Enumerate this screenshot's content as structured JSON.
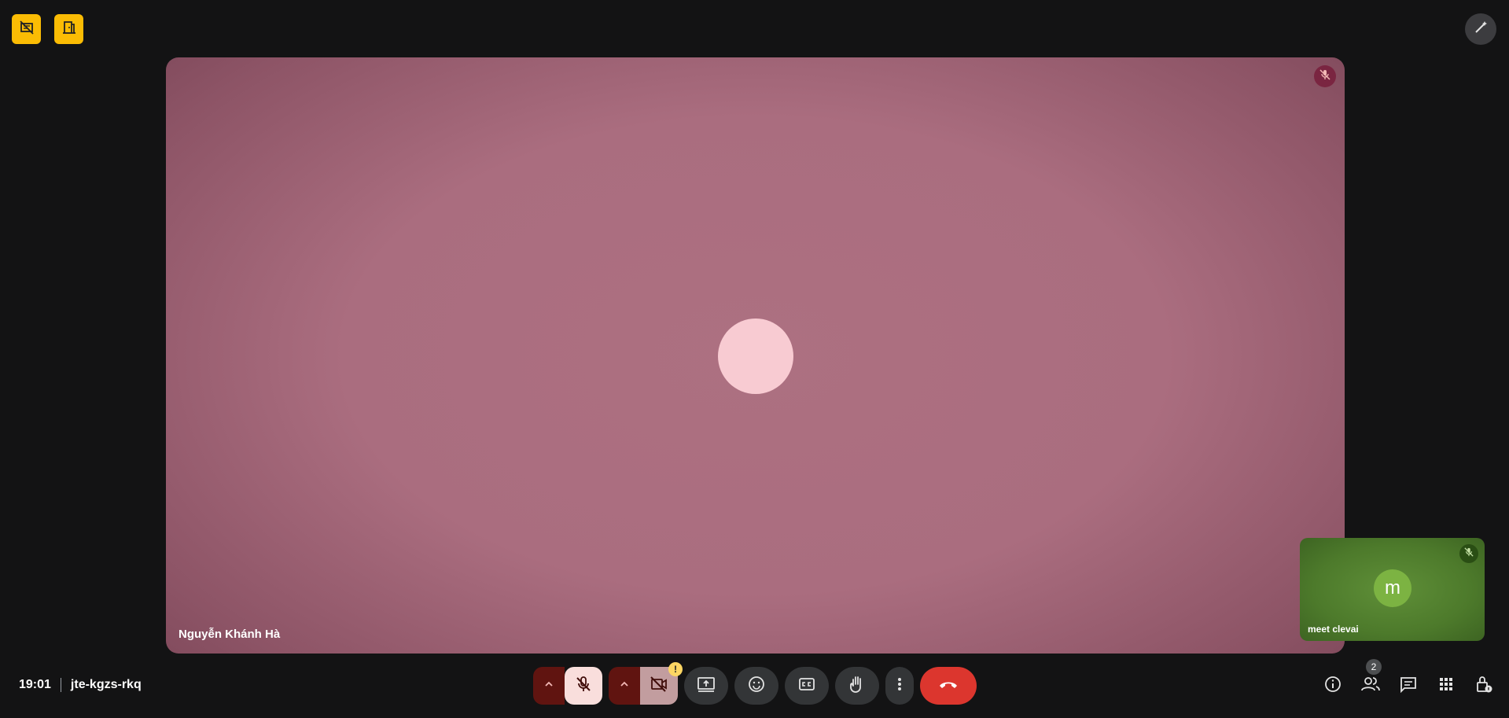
{
  "meeting": {
    "time": "19:01",
    "code": "jte-kgzs-rkq"
  },
  "participants": {
    "main": {
      "name": "Nguyễn Khánh Hà",
      "avatar_color": "#f8cbd2",
      "tile_color": "#ad7081",
      "muted": true
    },
    "self": {
      "name": "meet clevai",
      "initial": "m",
      "avatar_color": "#7cb342",
      "tile_color": "#4d7a2b",
      "muted": true
    }
  },
  "toolbar": {
    "people_count": "2",
    "camera_warning": "!"
  },
  "icons": {
    "top_left": [
      "no-video-layout-icon",
      "door-icon"
    ],
    "top_right": "magic-pen-icon",
    "controls": [
      "caret-up-icon",
      "mic-off-icon",
      "caret-up-icon",
      "video-off-icon",
      "present-screen-icon",
      "emoji-icon",
      "captions-icon",
      "raise-hand-icon",
      "more-vert-icon",
      "end-call-icon"
    ],
    "right": [
      "info-icon",
      "people-icon",
      "chat-icon",
      "apps-icon",
      "host-controls-icon"
    ]
  },
  "colors": {
    "background": "#131314",
    "accent_yellow": "#fbbc04",
    "end_call": "#dc362e",
    "mic_off_bg": "#f9dedc"
  }
}
